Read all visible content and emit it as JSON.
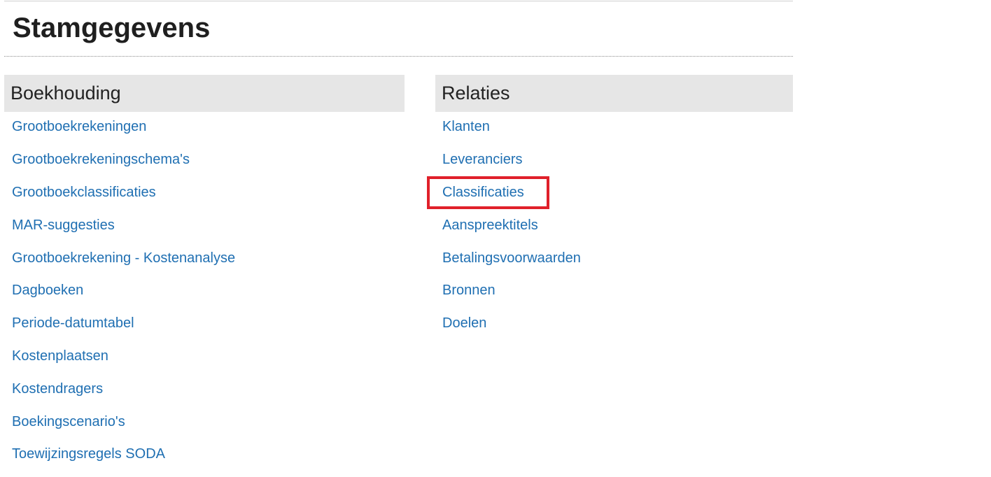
{
  "page": {
    "title": "Stamgegevens"
  },
  "sections": {
    "boekhouding": {
      "title": "Boekhouding",
      "links": [
        "Grootboekrekeningen",
        "Grootboekrekeningschema's",
        "Grootboekclassificaties",
        "MAR-suggesties",
        "Grootboekrekening - Kostenanalyse",
        "Dagboeken",
        "Periode-datumtabel",
        "Kostenplaatsen",
        "Kostendragers",
        "Boekingscenario's",
        "Toewijzingsregels SODA"
      ]
    },
    "relaties": {
      "title": "Relaties",
      "links": [
        "Klanten",
        "Leveranciers",
        "Classificaties",
        "Aanspreektitels",
        "Betalingsvoorwaarden",
        "Bronnen",
        "Doelen"
      ]
    }
  },
  "colors": {
    "link": "#1f6fb2",
    "section_header_bg": "#e6e6e6",
    "highlight": "#e0202a"
  }
}
